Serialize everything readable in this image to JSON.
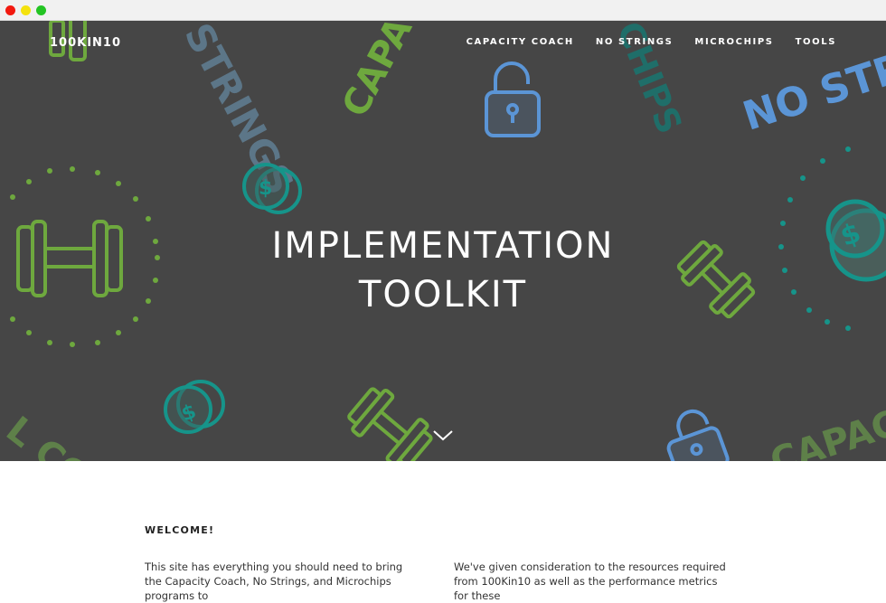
{
  "brand": "100KIN10",
  "nav": {
    "items": [
      "CAPACITY COACH",
      "NO STRINGS",
      "MICROCHIPS",
      "TOOLS"
    ]
  },
  "hero": {
    "title_line1": "IMPLEMENTATION",
    "title_line2": "TOOLKIT",
    "decor_words": [
      "STRINGS",
      "CAPACI",
      "CHIPS",
      "NO STRIN",
      "CAPACI",
      "L CO"
    ]
  },
  "welcome": {
    "heading": "WELCOME!",
    "left_text": "This site has everything you should need to bring the Capacity Coach, No Strings, and Microchips programs to",
    "right_text": "We've given consideration to the resources required from 100Kin10 as well as the performance metrics for these"
  },
  "colors": {
    "hero_bg": "#464646",
    "green": "#6ea83e",
    "teal": "#16948a",
    "blue": "#5b95d6",
    "slate": "#5c7688"
  }
}
